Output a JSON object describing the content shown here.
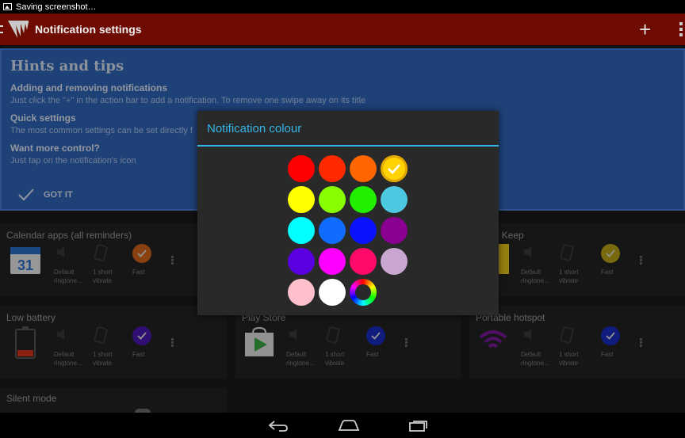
{
  "status_bar": {
    "text": "Saving screenshot…"
  },
  "action_bar": {
    "title": "Notification settings",
    "add_label": "+"
  },
  "hints": {
    "title": "Hints and tips",
    "sections": [
      {
        "heading": "Adding and removing notifications",
        "text": "Just click the \"+\" in the action bar to add a notification. To remove one swipe away on its title"
      },
      {
        "heading": "Quick settings",
        "text": "The most common settings can be set directly f"
      },
      {
        "heading": "Want more control?",
        "text": "Just tap on the notification's icon"
      }
    ],
    "got_it_label": "GOT IT"
  },
  "cards": [
    {
      "title": "Calendar apps (all reminders)",
      "sound": "Default ringtone...",
      "vibrate": "1 short vibrate",
      "light": "Fast",
      "light_color": "#d4641c"
    },
    {
      "title": "le Keep",
      "sound": "Default ringtone...",
      "vibrate": "1 short vibrate",
      "light": "Fast",
      "light_color": "#b8a414"
    },
    {
      "title": "Low battery",
      "sound": "Default ringtone...",
      "vibrate": "1 short vibrate",
      "light": "Fast",
      "light_color": "#4a18b0"
    },
    {
      "title": "Play Store",
      "sound": "Default ringtone...",
      "vibrate": "1 short vibrate",
      "light": "Fast",
      "light_color": "#1a2cc0"
    },
    {
      "title": "Portable hotspot",
      "sound": "Default ringtone...",
      "vibrate": "1 short vibrate",
      "light": "Fast",
      "light_color": "#1a2cc0"
    },
    {
      "title": "Silent mode"
    }
  ],
  "dialog": {
    "title": "Notification colour",
    "colors": [
      [
        "#ff0000",
        "#ff2a00",
        "#ff6600",
        "#ffd200"
      ],
      [
        "#ffff00",
        "#88ff00",
        "#22ee00",
        "#4cc8e0"
      ],
      [
        "#00ffff",
        "#0f6cff",
        "#0a12ff",
        "#8a0090"
      ],
      [
        "#5a00e0",
        "#ff00ff",
        "#ff0a6a",
        "#c8a6d0"
      ],
      [
        "#ffc0cc",
        "#ffffff",
        "custom-wheel"
      ]
    ],
    "selected_color": "#ffd200"
  },
  "nav": {
    "back": "back-icon",
    "home": "home-icon",
    "recents": "recents-icon"
  }
}
